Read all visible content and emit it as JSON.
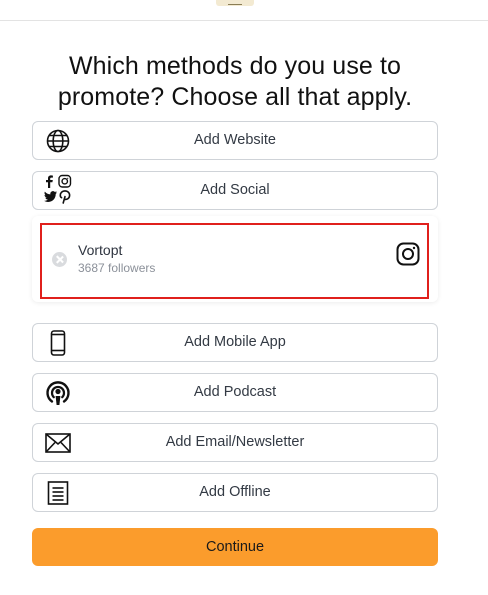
{
  "heading": "Which methods do you use to promote? Choose all that apply.",
  "options": [
    {
      "label": "Add Website",
      "icon": "globe-icon"
    },
    {
      "label": "Add Social",
      "icon": "social-icons-cluster"
    },
    {
      "label": "Add Mobile App",
      "icon": "mobile-phone-icon"
    },
    {
      "label": "Add Podcast",
      "icon": "podcast-icon"
    },
    {
      "label": "Add Email/Newsletter",
      "icon": "envelope-icon"
    },
    {
      "label": "Add Offline",
      "icon": "document-icon"
    }
  ],
  "social_account": {
    "name": "Vortopt",
    "followers": "3687 followers",
    "platform_icon": "instagram-icon"
  },
  "continue_label": "Continue",
  "colors": {
    "accent": "#fb9c2c",
    "highlight": "#e0201c",
    "border": "#cfd3d8"
  }
}
